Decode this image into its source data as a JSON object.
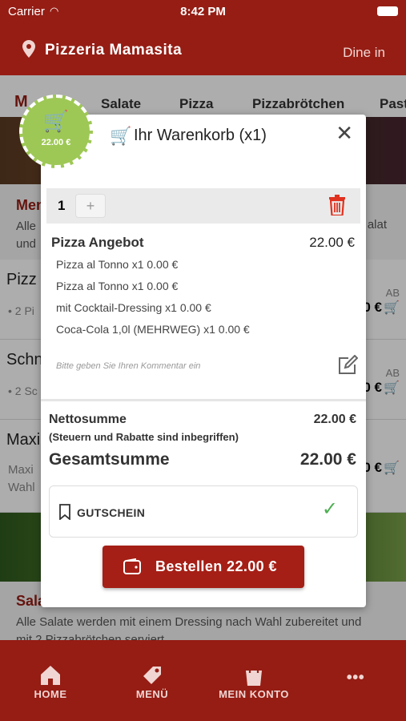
{
  "status": {
    "carrier": "Carrier",
    "time": "8:42 PM"
  },
  "header": {
    "title": "Pizzeria Mamasita",
    "mode": "Dine in"
  },
  "tabs": [
    "M",
    "Salate",
    "Pizza",
    "Pizzabrötchen",
    "Past"
  ],
  "menu_section": {
    "title": "Men",
    "text_line1": "Alle",
    "text_line2": "und",
    "text_right": "alat"
  },
  "items": [
    {
      "name": "Pizz",
      "sub": "• 2 Pi",
      "ab": "AB",
      "price": "0 €"
    },
    {
      "name": "Schn",
      "sub": "• 2 Sc",
      "ab": "AB",
      "price": "0 €"
    },
    {
      "name": "Maxi",
      "sub": "Maxi",
      "sub2": "Wahl",
      "price": "0 €"
    }
  ],
  "salate": {
    "title": "Sala",
    "text": "Alle Salate werden mit einem Dressing nach Wahl zubereitet und",
    "text2": "mit 2 Pizzabrötchen serviert"
  },
  "badge": {
    "amount": "22.00 €"
  },
  "cart": {
    "title": "Ihr Warenkorb (x1)",
    "quantity": "1",
    "plus": "+",
    "product": "Pizza Angebot",
    "product_price": "22.00 €",
    "options": [
      "Pizza al Tonno x1 0.00 €",
      "Pizza al Tonno x1 0.00 €",
      "mit Cocktail-Dressing x1 0.00 €",
      "Coca-Cola 1,0l (MEHRWEG) x1 0.00 €"
    ],
    "comment_placeholder": "Bitte geben Sie Ihren Kommentar ein",
    "net_label": "Nettosumme",
    "net_value": "22.00 €",
    "tax_note": "(Steuern und Rabatte sind inbegriffen)",
    "total_label": "Gesamtsumme",
    "total_value": "22.00 €",
    "voucher_label": "GUTSCHEIN",
    "order_button": "Bestellen 22.00 €"
  },
  "bottomnav": {
    "home": "HOME",
    "menu": "MENÜ",
    "account": "MEIN KONTO",
    "more": "•••"
  },
  "colors": {
    "brand": "#951d14",
    "accent_green": "#9ec855",
    "check": "#4caf50"
  }
}
